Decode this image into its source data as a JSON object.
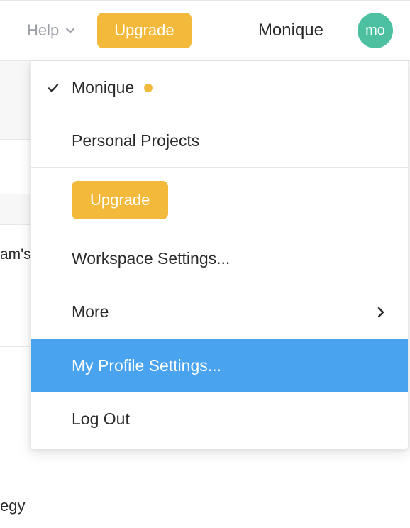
{
  "topbar": {
    "help_label": "Help",
    "upgrade_label": "Upgrade",
    "username": "Monique",
    "avatar_initials": "mo"
  },
  "background": {
    "partial_label_1": "am's",
    "partial_label_2": "egy"
  },
  "menu": {
    "workspace_name": "Monique",
    "personal_projects_label": "Personal Projects",
    "upgrade_label": "Upgrade",
    "workspace_settings_label": "Workspace Settings...",
    "more_label": "More",
    "profile_settings_label": "My Profile Settings...",
    "logout_label": "Log Out"
  },
  "colors": {
    "accent_orange": "#f2b93b",
    "highlight_blue": "#4aa3ef",
    "avatar_teal": "#4cc0a0"
  }
}
